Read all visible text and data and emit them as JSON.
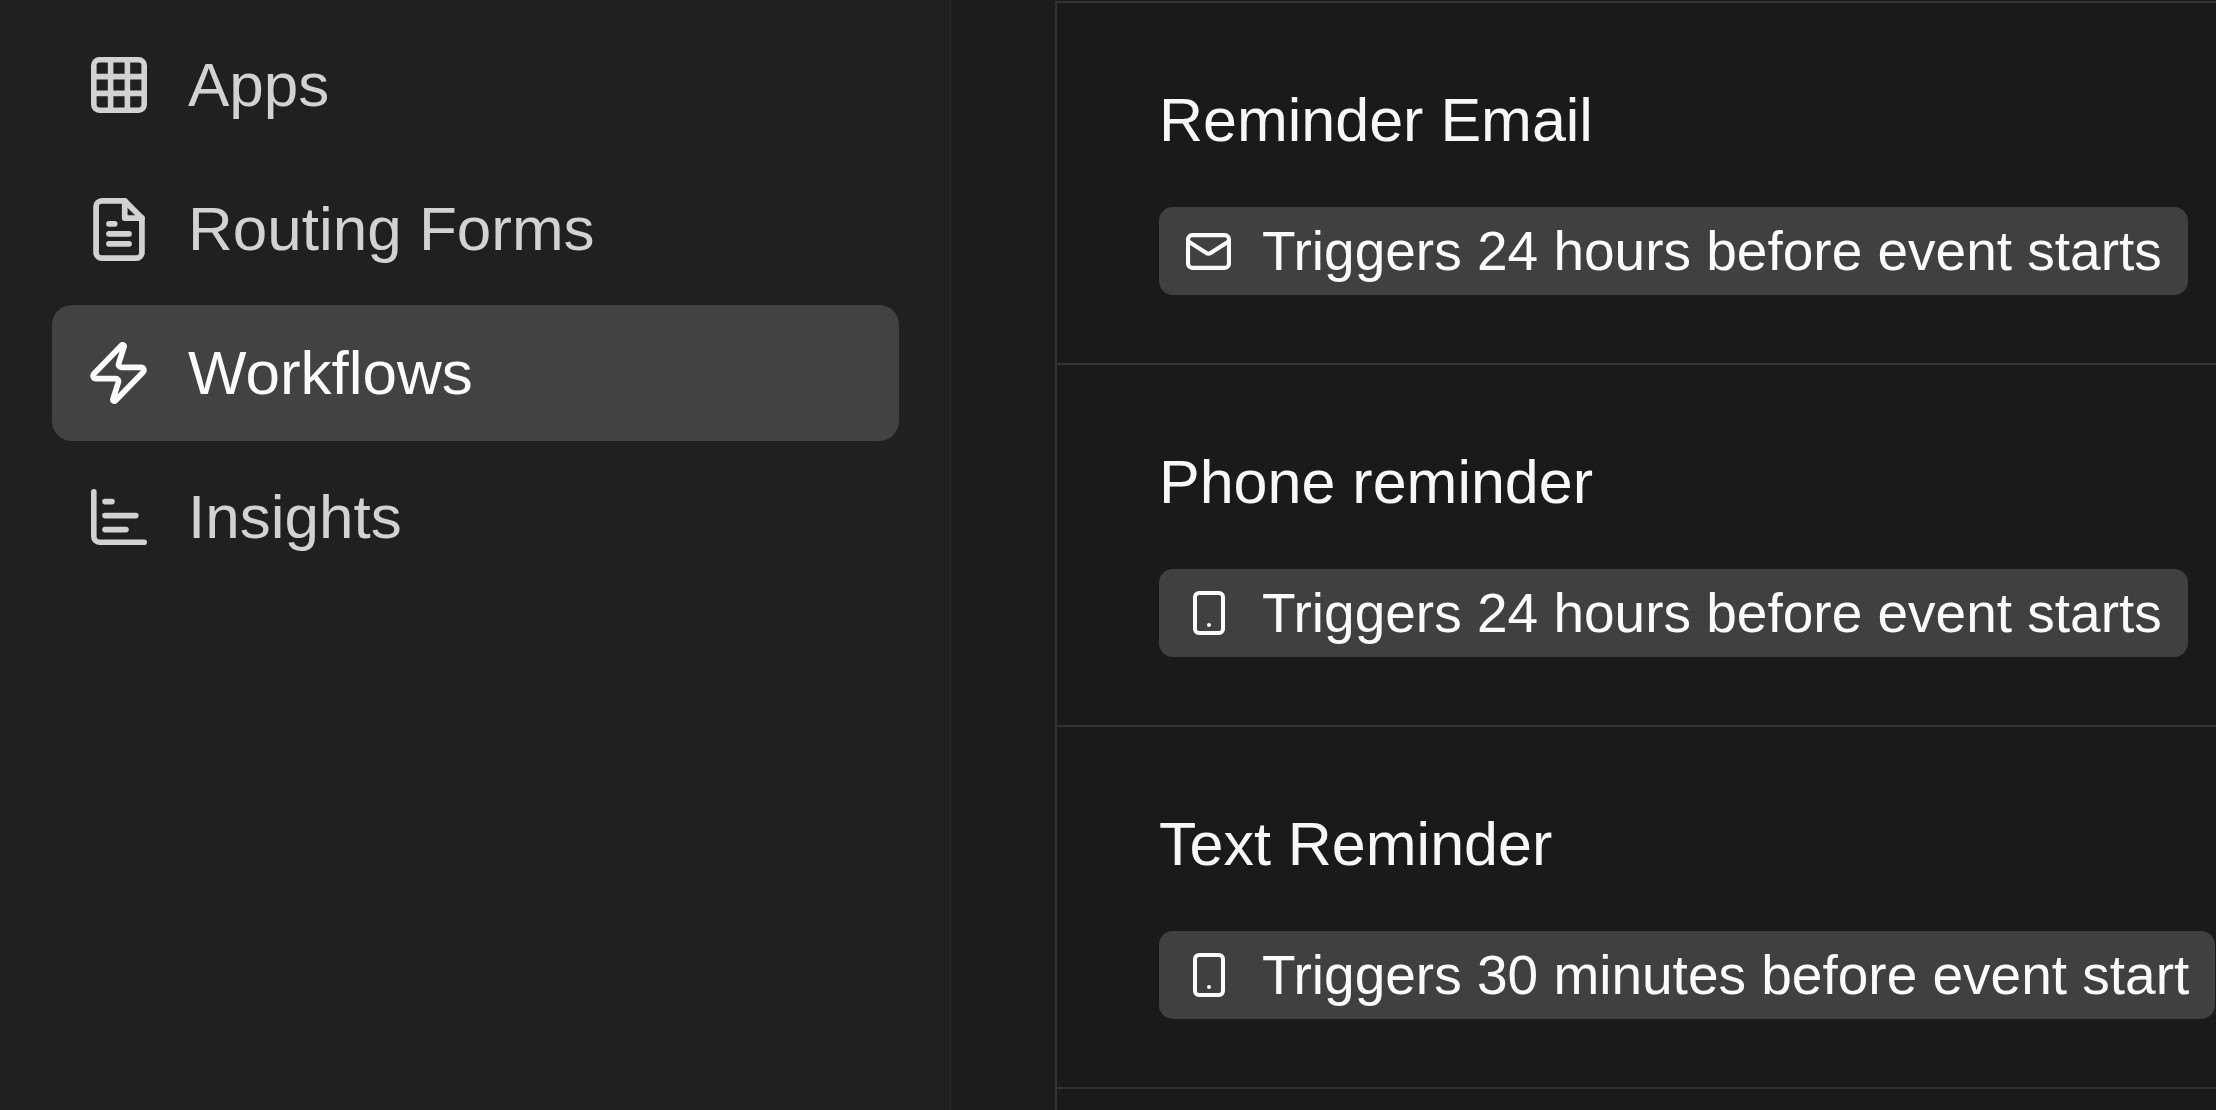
{
  "sidebar": {
    "items": [
      {
        "label": "Apps",
        "selected": false
      },
      {
        "label": "Routing Forms",
        "selected": false
      },
      {
        "label": "Workflows",
        "selected": true
      },
      {
        "label": "Insights",
        "selected": false
      }
    ]
  },
  "workflows": [
    {
      "title": "Reminder Email",
      "trigger": {
        "kind": "email",
        "text": "Triggers 24 hours before event starts"
      }
    },
    {
      "title": "Phone reminder",
      "trigger": {
        "kind": "phone",
        "text": "Triggers 24 hours before event starts"
      }
    },
    {
      "title": "Text Reminder",
      "trigger": {
        "kind": "phone",
        "text": "Triggers 30 minutes before event start"
      }
    }
  ]
}
